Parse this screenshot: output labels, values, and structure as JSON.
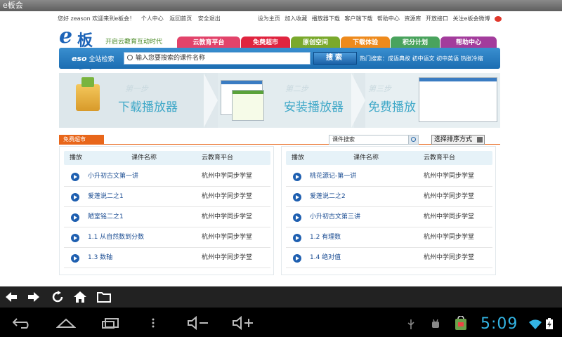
{
  "window": {
    "title": "e板会"
  },
  "toplinks": {
    "greeting": "您好 zeason 欢迎来到e板会！",
    "left_items": [
      "个人中心",
      "返回首页",
      "安全退出"
    ],
    "right_items": [
      "设为主页",
      "加入收藏",
      "播放器下载",
      "客户端下载",
      "帮助中心",
      "资源库",
      "开放接口",
      "关注e板会微博"
    ]
  },
  "logo": {
    "e": "e",
    "ban": "板会"
  },
  "slogan": "开启云教育互动时代",
  "nav": {
    "tabs": [
      {
        "label": "云教育平台",
        "color": "#e2436a"
      },
      {
        "label": "免费超市",
        "color": "#e0243f"
      },
      {
        "label": "原创空间",
        "color": "#7aa92c"
      },
      {
        "label": "下载体验",
        "color": "#ee8a1c"
      },
      {
        "label": "积分计划",
        "color": "#49a35d"
      },
      {
        "label": "帮助中心",
        "color": "#a33c9c"
      }
    ]
  },
  "search": {
    "brand": "eso",
    "brand_label": "全站检索",
    "placeholder": "输入您要搜索的课件名称",
    "button": "搜索",
    "hot_label": "热门搜索：",
    "hot_terms": "成语典故 初中语文 初中英语 热胀冷缩"
  },
  "banner": {
    "steps": [
      {
        "num": "第一步",
        "label": "下载播放器"
      },
      {
        "num": "第二步",
        "label": "安装播放器"
      },
      {
        "num": "第三步",
        "label": "免费播放"
      }
    ]
  },
  "content": {
    "section_tag": "免费超市",
    "course_search": "课件搜索",
    "sort_label": "选择排序方式",
    "columns": {
      "play": "播放",
      "name": "课件名称",
      "platform": "云教育平台"
    },
    "left_rows": [
      {
        "name": "小升初古文第一讲",
        "platform": "杭州中学同步学堂"
      },
      {
        "name": "爱莲说二之1",
        "platform": "杭州中学同步学堂"
      },
      {
        "name": "陋室铭二之1",
        "platform": "杭州中学同步学堂"
      },
      {
        "name": "1.1 从自然数到分数",
        "platform": "杭州中学同步学堂"
      },
      {
        "name": "1.3 数轴",
        "platform": "杭州中学同步学堂"
      }
    ],
    "right_rows": [
      {
        "name": "桃花源记-第一讲",
        "platform": "杭州中学同步学堂"
      },
      {
        "name": "爱莲说二之2",
        "platform": "杭州中学同步学堂"
      },
      {
        "name": "小升初古文第三讲",
        "platform": "杭州中学同步学堂"
      },
      {
        "name": "1.2 有理数",
        "platform": "杭州中学同步学堂"
      },
      {
        "name": "1.4 绝对值",
        "platform": "杭州中学同步学堂"
      }
    ]
  },
  "browser_toolbar": {
    "icons": [
      "back-arrow-icon",
      "forward-arrow-icon",
      "refresh-icon",
      "home-icon",
      "folder-icon"
    ]
  },
  "system_bar": {
    "time": "5:09"
  }
}
